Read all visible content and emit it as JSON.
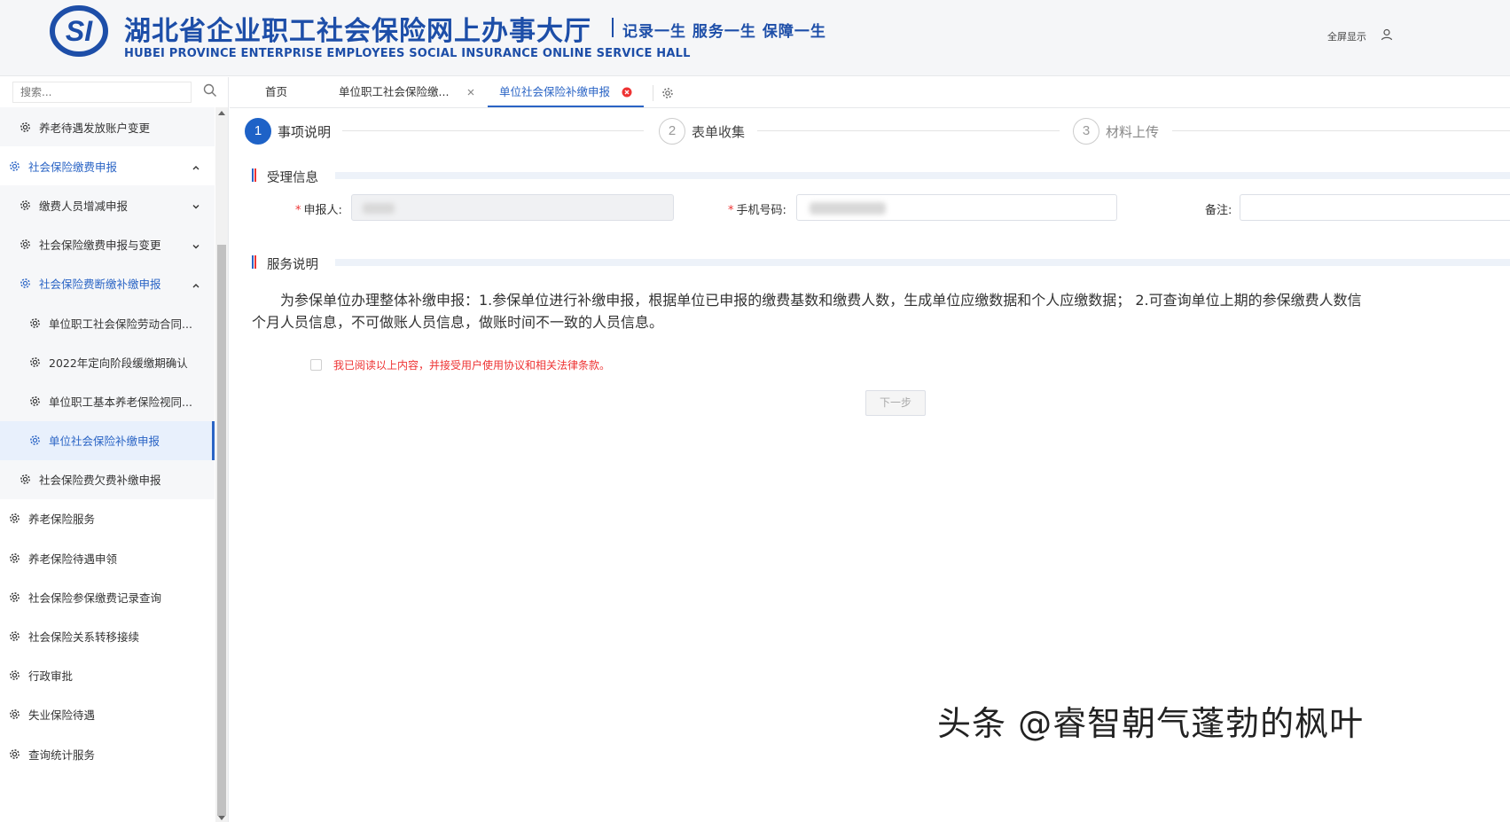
{
  "header": {
    "title_cn": "湖北省企业职工社会保险网上办事大厅",
    "slogan": "记录一生 服务一生 保障一生",
    "title_en": "HUBEI PROVINCE ENTERPRISE EMPLOYEES SOCIAL INSURANCE ONLINE SERVICE HALL",
    "fullscreen_label": "全屏显示",
    "logo_letters": "SI",
    "user_icon": "user-icon"
  },
  "sidebar": {
    "search_placeholder": "搜索...",
    "items": [
      {
        "label": "养老待遇发放账户变更",
        "level": 2
      },
      {
        "label": "社会保险缴费申报",
        "level": 1,
        "state": "open"
      },
      {
        "label": "缴费人员增减申报",
        "level": 2
      },
      {
        "label": "社会保险缴费申报与变更",
        "level": 2
      },
      {
        "label": "社会保险费断缴补缴申报",
        "level": 2,
        "state": "open"
      },
      {
        "label": "单位职工社会保险劳动合同...",
        "level": 3
      },
      {
        "label": "2022年定向阶段缓缴期确认",
        "level": 3
      },
      {
        "label": "单位职工基本养老保险视同...",
        "level": 3
      },
      {
        "label": "单位社会保险补缴申报",
        "level": 3,
        "state": "active"
      },
      {
        "label": "社会保险费欠费补缴申报",
        "level": 2
      },
      {
        "label": "养老保险服务",
        "level": 1
      },
      {
        "label": "养老保险待遇申领",
        "level": 1
      },
      {
        "label": "社会保险参保缴费记录查询",
        "level": 1
      },
      {
        "label": "社会保险关系转移接续",
        "level": 1
      },
      {
        "label": "行政审批",
        "level": 1
      },
      {
        "label": "失业保险待遇",
        "level": 1
      },
      {
        "label": "查询统计服务",
        "level": 1
      }
    ]
  },
  "tabs": [
    {
      "label": "首页"
    },
    {
      "label": "单位职工社会保险缴..."
    },
    {
      "label": "单位社会保险补缴申报",
      "active": true
    }
  ],
  "steps": [
    {
      "num": "1",
      "label": "事项说明"
    },
    {
      "num": "2",
      "label": "表单收集"
    },
    {
      "num": "3",
      "label": "材料上传"
    }
  ],
  "accept_section": {
    "title": "受理信息",
    "applicant_label": "申报人:",
    "phone_label": "手机号码:",
    "remark_label": "备注:"
  },
  "service_section": {
    "title": "服务说明",
    "line1": "为参保单位办理整体补缴申报：1.参保单位进行补缴申报，根据单位已申报的缴费基数和缴费人数，生成单位应缴数据和个人应缴数据； 2.可查询单位上期的参保缴费人数信",
    "line2": "个月人员信息，不可做账人员信息，做账时间不一致的人员信息。"
  },
  "agree_text": "我已阅读以上内容，并接受用户使用协议和相关法律条款。",
  "next_button": "下一步",
  "watermark": "头条 @睿智朝气蓬勃的枫叶",
  "colors": {
    "brand": "#1d4ea8",
    "accent": "#2a64c5",
    "required": "#ee3333"
  }
}
